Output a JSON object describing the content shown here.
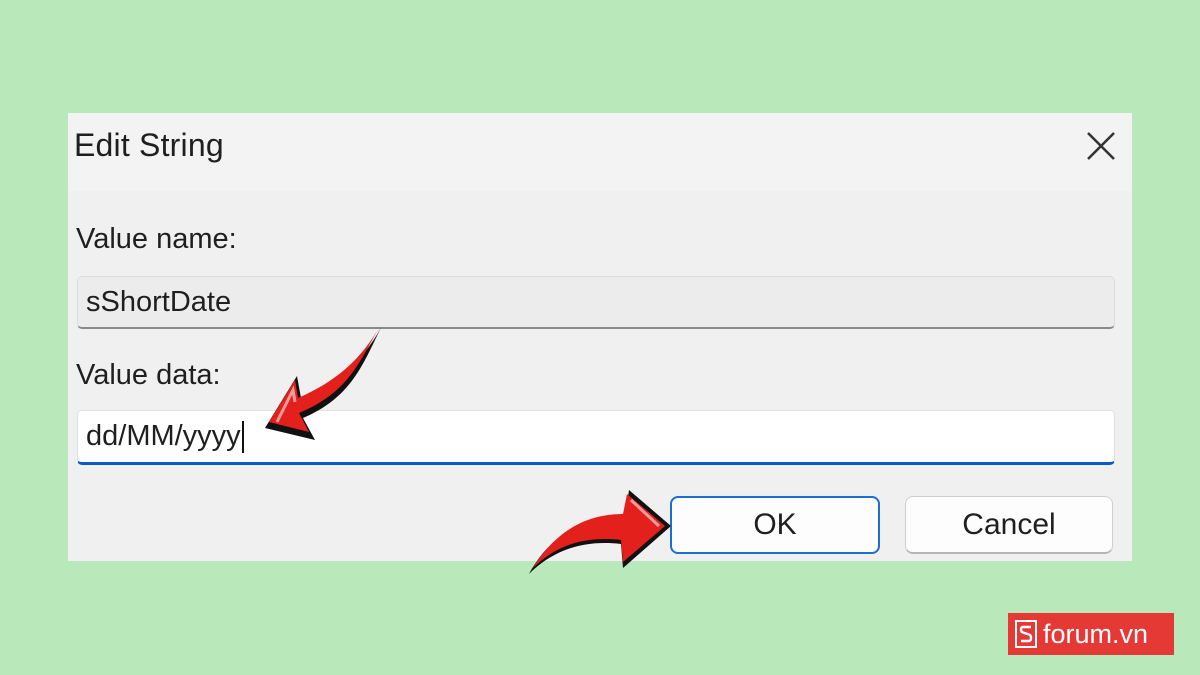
{
  "dialog": {
    "title": "Edit String",
    "value_name_label": "Value name:",
    "value_name": "sShortDate",
    "value_data_label": "Value data:",
    "value_data": "dd/MM/yyyy",
    "ok_label": "OK",
    "cancel_label": "Cancel"
  },
  "watermark": {
    "text": "forum.vn"
  },
  "icons": {
    "close": "close-icon",
    "annotation_arrow": "red-arrow-icon",
    "logo": "sforum-logo-icon"
  },
  "colors": {
    "background": "#b9e9bb",
    "focus_accent": "#0a5cc2",
    "arrow_red": "#e3201b",
    "logo_red": "#e53935"
  }
}
